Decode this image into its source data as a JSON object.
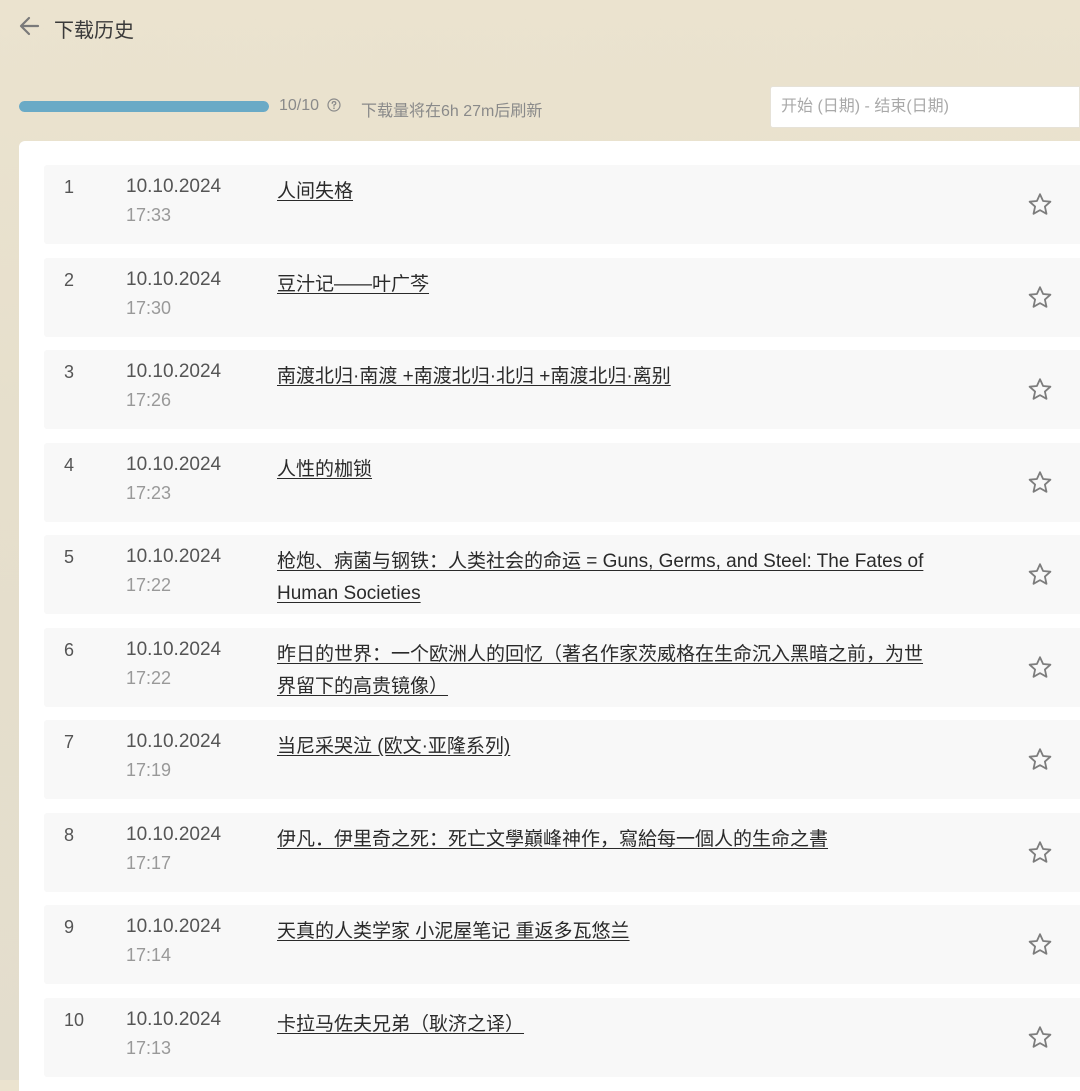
{
  "header": {
    "title": "下载历史",
    "back_icon": "arrow-left-icon"
  },
  "quota": {
    "count": "10/10",
    "progress": 1.0,
    "help_icon": "question-circle-icon",
    "refresh_text": "下载量将在6h 27m后刷新",
    "bar_color": "#6aaac6"
  },
  "date_filter": {
    "placeholder": "开始 (日期) - 结束(日期)",
    "value": ""
  },
  "downloads": [
    {
      "index": "1",
      "date": "10.10.2024",
      "time": "17:33",
      "title": "人间失格"
    },
    {
      "index": "2",
      "date": "10.10.2024",
      "time": "17:30",
      "title": "豆汁记——叶广芩"
    },
    {
      "index": "3",
      "date": "10.10.2024",
      "time": "17:26",
      "title": "南渡北归·南渡 +南渡北归·北归 +南渡北归·离别"
    },
    {
      "index": "4",
      "date": "10.10.2024",
      "time": "17:23",
      "title": "人性的枷锁"
    },
    {
      "index": "5",
      "date": "10.10.2024",
      "time": "17:22",
      "title": "枪炮、病菌与钢铁：人类社会的命运 = Guns, Germs, and Steel: The Fates of Human Societies"
    },
    {
      "index": "6",
      "date": "10.10.2024",
      "time": "17:22",
      "title": "昨日的世界：一个欧洲人的回忆（著名作家茨威格在生命沉入黑暗之前，为世界留下的高贵镜像）"
    },
    {
      "index": "7",
      "date": "10.10.2024",
      "time": "17:19",
      "title": "当尼采哭泣 (欧文·亚隆系列)"
    },
    {
      "index": "8",
      "date": "10.10.2024",
      "time": "17:17",
      "title": "伊凡．伊里奇之死：死亡文學巔峰神作，寫給每一個人的生命之書"
    },
    {
      "index": "9",
      "date": "10.10.2024",
      "time": "17:14",
      "title": "天真的人类学家 小泥屋笔记 重返多瓦悠兰"
    },
    {
      "index": "10",
      "date": "10.10.2024",
      "time": "17:13",
      "title": "卡拉马佐夫兄弟（耿济之译）"
    }
  ],
  "icons": {
    "star": "star-outline-icon"
  }
}
